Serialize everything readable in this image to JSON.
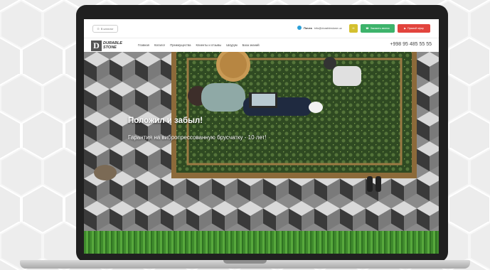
{
  "topbar": {
    "back_label": "В каталог",
    "contact_label": "Почта",
    "contact_email": "info@durablestone.uz",
    "call_label": "Заказать звонок",
    "video_label": "Прямой эфир"
  },
  "nav": {
    "logo_letter": "D",
    "logo_line1": "DURABLE",
    "logo_line2": "STONE",
    "items": [
      "Главная",
      "Каталог",
      "Преимущества",
      "Клиенты и отзывы",
      "Шоурум",
      "База знаний"
    ],
    "phone": "+998 95 485 55 55"
  },
  "hero": {
    "title": "Положил и забыл!",
    "subtitle": "Гарантия на вибропрессованную брусчатку - 10 лет!"
  },
  "colors": {
    "call_green": "#3db36b",
    "video_red": "#e2443d",
    "mail_yellow": "#d4c02f",
    "telegram_blue": "#2a9fd8"
  },
  "icons": [
    "back-arrow-icon",
    "telegram-icon",
    "mail-icon",
    "phone-icon",
    "video-icon"
  ]
}
